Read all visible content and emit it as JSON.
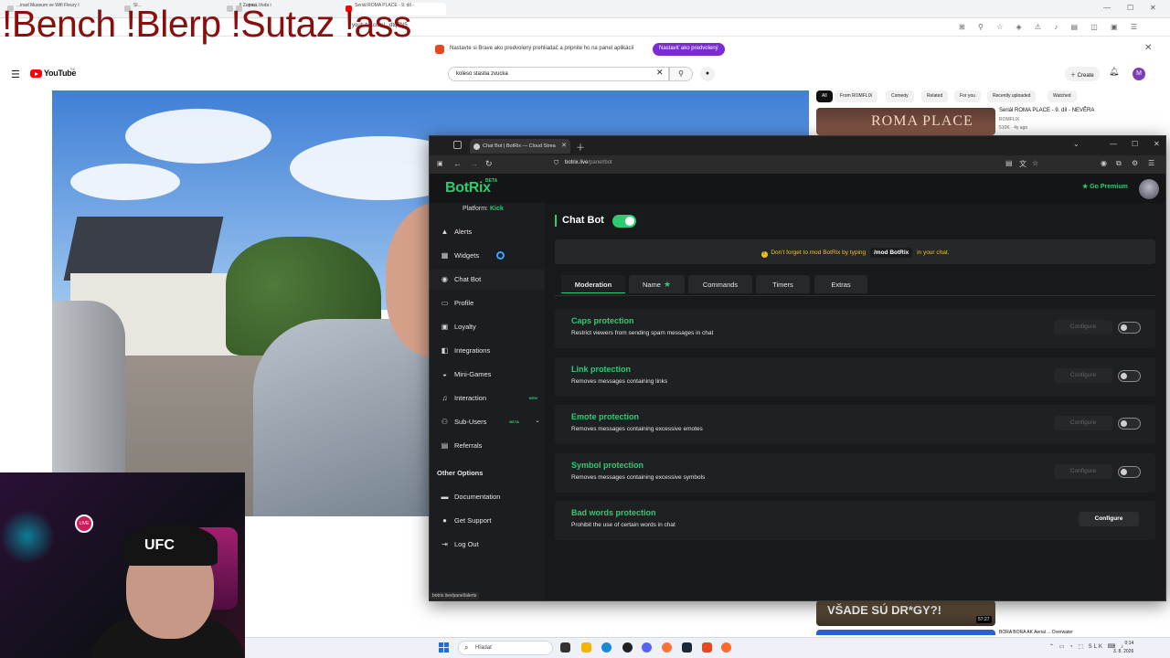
{
  "stream_overlay_text": "!Bench !Blerp !Sutaz !ass",
  "background_browser": {
    "tabs": [
      "...inad Museum ve Wifi Fleury I",
      "Sl...",
      "...ll Zemná Voda i",
      "...jeu...",
      "Seriál ROMA PLACE - 9. dil -"
    ],
    "url": "youtube.com/...dtqZN5",
    "notice_text": "Nastavte si Brave ako predvolený prehliadač a pripnite ho na panel aplikácií",
    "notice_button": "Nastaviť ako predvolený"
  },
  "youtube": {
    "logo": "YouTube",
    "region": "SK",
    "search_value": "koleso stastia zvucka",
    "create_label": "Create",
    "avatar_letter": "M",
    "chips": [
      "All",
      "From ROMFLIX",
      "Comedy",
      "Related",
      "For you",
      "Recently uploaded",
      "Watched"
    ],
    "rec1": {
      "thumb_text": "ROMA PLACE",
      "title": "Seriál ROMA PLACE - 9. díl - NEVĚRA",
      "channel": "ROMFLIX",
      "meta": "510K · 4y ago"
    },
    "rec2": {
      "thumb_text": "VŠADE SÚ DR*GY?!",
      "duration": "57:27"
    },
    "rec3": {
      "title": "BORA BORA AK Aerial ... Overwater"
    }
  },
  "webcam": {
    "live_badge": "LIVE",
    "cap_text": "UFC"
  },
  "taskbar": {
    "search_placeholder": "Hľadať",
    "language": "SLK",
    "time": "0:14",
    "date": "3. 8. 2026"
  },
  "botrix_window": {
    "tab_title": "Chat Bot | BotRix — Cloud Strea",
    "address_host": "botrix.live",
    "address_path": "/panel/bot",
    "status_url": "botrix.live/panel/alerts"
  },
  "botrix": {
    "brand": "BotRix",
    "brand_badge": "BETA",
    "go_premium": "Go Premium",
    "platform_label": "Platform:",
    "platform_value": "Kick",
    "sidebar": [
      {
        "label": "Alerts",
        "icon": "warning-icon"
      },
      {
        "label": "Widgets",
        "icon": "widgets-icon"
      },
      {
        "label": "Chat Bot",
        "icon": "chat-bubble-icon"
      },
      {
        "label": "Profile",
        "icon": "profile-card-icon"
      },
      {
        "label": "Loyalty",
        "icon": "gift-icon"
      },
      {
        "label": "Integrations",
        "icon": "puzzle-icon"
      },
      {
        "label": "Mini-Games",
        "icon": "gamepad-icon"
      },
      {
        "label": "Interaction",
        "icon": "music-note-icon",
        "badge": "NEW"
      },
      {
        "label": "Sub-Users",
        "icon": "users-icon",
        "badge": "BETA"
      },
      {
        "label": "Referrals",
        "icon": "referral-icon"
      }
    ],
    "other_options_heading": "Other Options",
    "other_options": [
      {
        "label": "Documentation",
        "icon": "document-icon"
      },
      {
        "label": "Get Support",
        "icon": "support-icon"
      },
      {
        "label": "Log Out",
        "icon": "logout-icon"
      }
    ],
    "page_title": "Chat Bot",
    "notice": {
      "before": "Don't forget to mod BotRix by typing",
      "command": "/mod BotRix",
      "after": "in your chat."
    },
    "tabs": [
      "Moderation",
      "Name",
      "Commands",
      "Timers",
      "Extras"
    ],
    "features": [
      {
        "title": "Caps protection",
        "desc": "Restrict viewers from sending spam messages in chat",
        "configure": "Configure"
      },
      {
        "title": "Link protection",
        "desc": "Removes messages containing links",
        "configure": "Configure"
      },
      {
        "title": "Emote protection",
        "desc": "Removes messages containing excessive emotes",
        "configure": "Configure"
      },
      {
        "title": "Symbol protection",
        "desc": "Removes messages containing excessive symbols",
        "configure": "Configure"
      },
      {
        "title": "Bad words protection",
        "desc": "Prohibit the use of certain words in chat",
        "configure": "Configure"
      }
    ]
  }
}
